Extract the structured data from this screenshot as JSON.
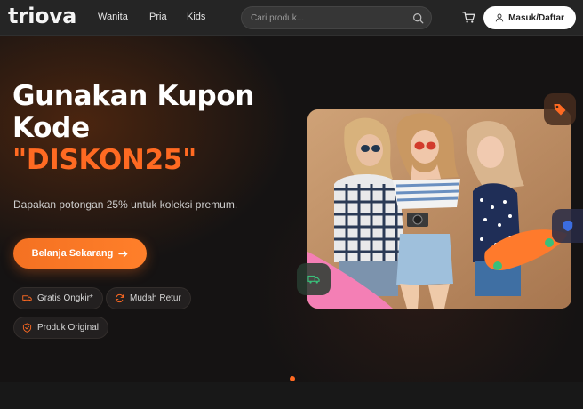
{
  "header": {
    "logo": "triova",
    "nav": [
      "Wanita",
      "Pria",
      "Kids"
    ],
    "search_placeholder": "Cari produk...",
    "login_label": "Masuk/Daftar"
  },
  "hero": {
    "headline_line1": "Gunakan Kupon",
    "headline_line2": "Kode",
    "coupon_code": "\"DISKON25\"",
    "subtitle": "Dapakan potongan 25% untuk koleksi premum.",
    "cta_label": "Belanja Sekarang",
    "features": [
      "Gratis Ongkir*",
      "Mudah Retur",
      "Produk Original"
    ]
  },
  "icons": {
    "search": "search-icon",
    "cart": "cart-icon",
    "user": "user-icon",
    "arrow": "arrow-right-icon",
    "truck": "truck-icon",
    "return": "refresh-icon",
    "shield": "shield-icon",
    "tag": "tag-icon"
  },
  "colors": {
    "accent": "#ff6a22",
    "header_bg": "#252525",
    "page_bg": "#151313"
  },
  "carousel": {
    "active_index": 0,
    "count": 1
  }
}
